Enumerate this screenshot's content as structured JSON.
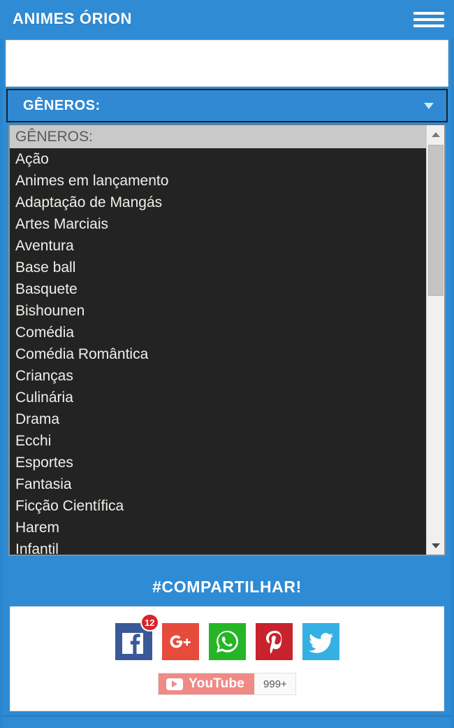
{
  "header": {
    "title": "ANIMES ÓRION",
    "menu_icon": "hamburger-menu-icon",
    "background_color": "#2f8bd4"
  },
  "search": {
    "value": "",
    "placeholder": ""
  },
  "genre_select": {
    "label": "GÊNEROS:",
    "expanded": true,
    "caret_icon": "chevron-down-icon",
    "background_color": "#3089d2",
    "options": [
      "GÊNEROS:",
      "Ação",
      "Animes em lançamento",
      "Adaptação de Mangás",
      "Artes Marciais",
      "Aventura",
      "Base ball",
      "Basquete",
      "Bishounen",
      "Comédia",
      "Comédia Romântica",
      "Crianças",
      "Culinária",
      "Drama",
      "Ecchi",
      "Esportes",
      "Fantasia",
      "Ficção Científica",
      "Harem",
      "Infantil"
    ],
    "selected": "GÊNEROS:",
    "list_background_color": "#232323",
    "list_text_color": "#f0efe9"
  },
  "scrollbar": {
    "up_icon": "arrow-up-icon",
    "down_icon": "arrow-down-icon",
    "thumb_position_percent": 4
  },
  "share": {
    "title": "#COMPARTILHAR!",
    "buttons": [
      {
        "name": "facebook",
        "icon": "facebook-icon",
        "color": "#3b5998",
        "badge": "12"
      },
      {
        "name": "google-plus",
        "icon": "google-plus-icon",
        "color": "#e74b3b",
        "badge": ""
      },
      {
        "name": "whatsapp",
        "icon": "whatsapp-icon",
        "color": "#25b628",
        "badge": ""
      },
      {
        "name": "pinterest",
        "icon": "pinterest-icon",
        "color": "#c8232c",
        "badge": ""
      },
      {
        "name": "twitter",
        "icon": "twitter-icon",
        "color": "#35b0e3",
        "badge": ""
      }
    ],
    "youtube": {
      "label": "YouTube",
      "count": "999+",
      "icon": "youtube-play-icon",
      "color": "#f08a86"
    }
  }
}
